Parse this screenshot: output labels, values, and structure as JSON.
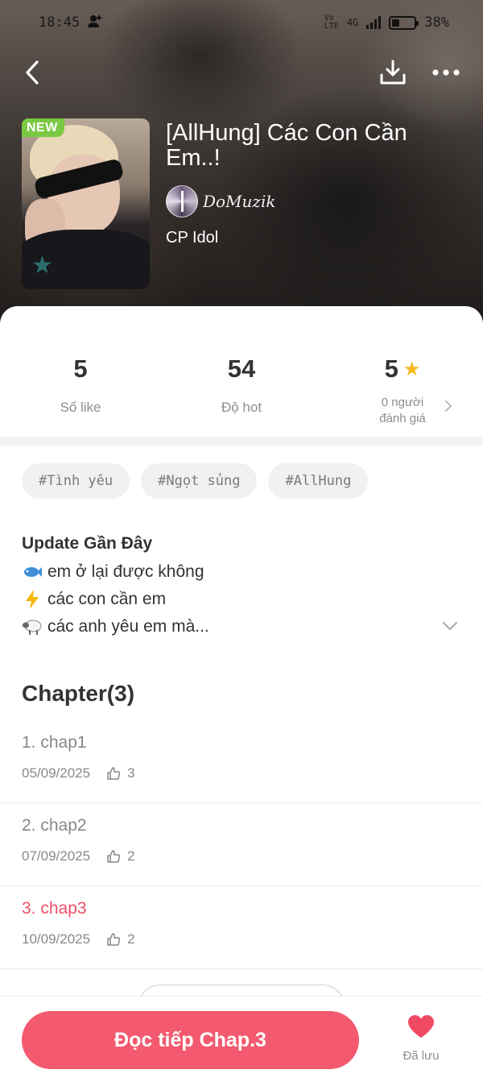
{
  "status_bar": {
    "time": "18:45",
    "network": "4G",
    "battery": "38%"
  },
  "story": {
    "badge": "NEW",
    "title": "[AllHung] Các Con Cần Em..!",
    "author": "DoMuzik",
    "category": "CP Idol"
  },
  "stats": [
    {
      "value": "5",
      "label": "Số like"
    },
    {
      "value": "54",
      "label": "Độ hot"
    },
    {
      "value": "5",
      "label_line1": "0 người",
      "label_line2": "đánh giá"
    }
  ],
  "tags": [
    "#Tình yêu",
    "#Ngọt sủng",
    "#AllHung"
  ],
  "update": {
    "title": "Update Gần Đây",
    "lines": [
      {
        "emoji": "fish-icon",
        "text": "em ở lại được không"
      },
      {
        "emoji": "lightning-icon",
        "text": "các con cần em"
      },
      {
        "emoji": "sheep-icon",
        "text": "các anh yêu em mà..."
      }
    ]
  },
  "chapters": {
    "heading": "Chapter(3)",
    "items": [
      {
        "title": "1. chap1",
        "date": "05/09/2025",
        "likes": "3",
        "active": false
      },
      {
        "title": "2. chap2",
        "date": "07/09/2025",
        "likes": "2",
        "active": false
      },
      {
        "title": "3. chap3",
        "date": "10/09/2025",
        "likes": "2",
        "active": true
      }
    ]
  },
  "bottom": {
    "read_button": "Đọc tiếp Chap.3",
    "saved_label": "Đã lưu"
  },
  "colors": {
    "accent": "#f35a6f",
    "active_chapter": "#ee5168",
    "new_badge": "#7ac943",
    "rating_star": "#f6b81a"
  }
}
